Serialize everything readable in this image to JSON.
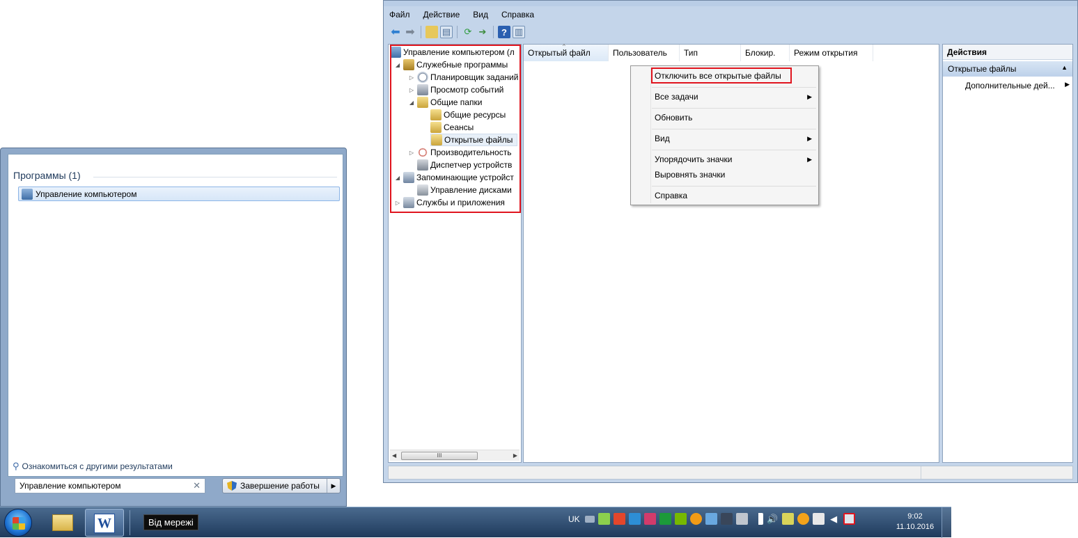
{
  "start_menu": {
    "header": "Программы (1)",
    "result": "Управление компьютером",
    "more_results": "Ознакомиться с другими результатами",
    "search_value": "Управление компьютером",
    "shutdown_label": "Завершение работы"
  },
  "taskbar": {
    "tooltip": "Від мережі",
    "lang": "UK",
    "time": "9:02",
    "date": "11.10.2016"
  },
  "window": {
    "menu": [
      "Файл",
      "Действие",
      "Вид",
      "Справка"
    ],
    "tree": [
      "Управление компьютером (л",
      "Служебные программы",
      "Планировщик заданий",
      "Просмотр событий",
      "Общие папки",
      "Общие ресурсы",
      "Сеансы",
      "Открытые файлы",
      "Производительность",
      "Диспетчер устройств",
      "Запоминающие устройст",
      "Управление дисками",
      "Службы и приложения"
    ],
    "scroll_thumb": "III",
    "columns": [
      "Открытый файл",
      "Пользователь",
      "Тип",
      "Блокир.",
      "Режим открытия"
    ],
    "actions": {
      "header": "Действия",
      "section": "Открытые файлы",
      "item": "Дополнительные дей..."
    }
  },
  "context_menu": {
    "items": [
      "Отключить все открытые файлы",
      "Все задачи",
      "Обновить",
      "Вид",
      "Упорядочить значки",
      "Выровнять значки",
      "Справка"
    ]
  },
  "colors": {
    "highlight_box": "#e0141e",
    "taskbar": "#1f3a5c"
  }
}
